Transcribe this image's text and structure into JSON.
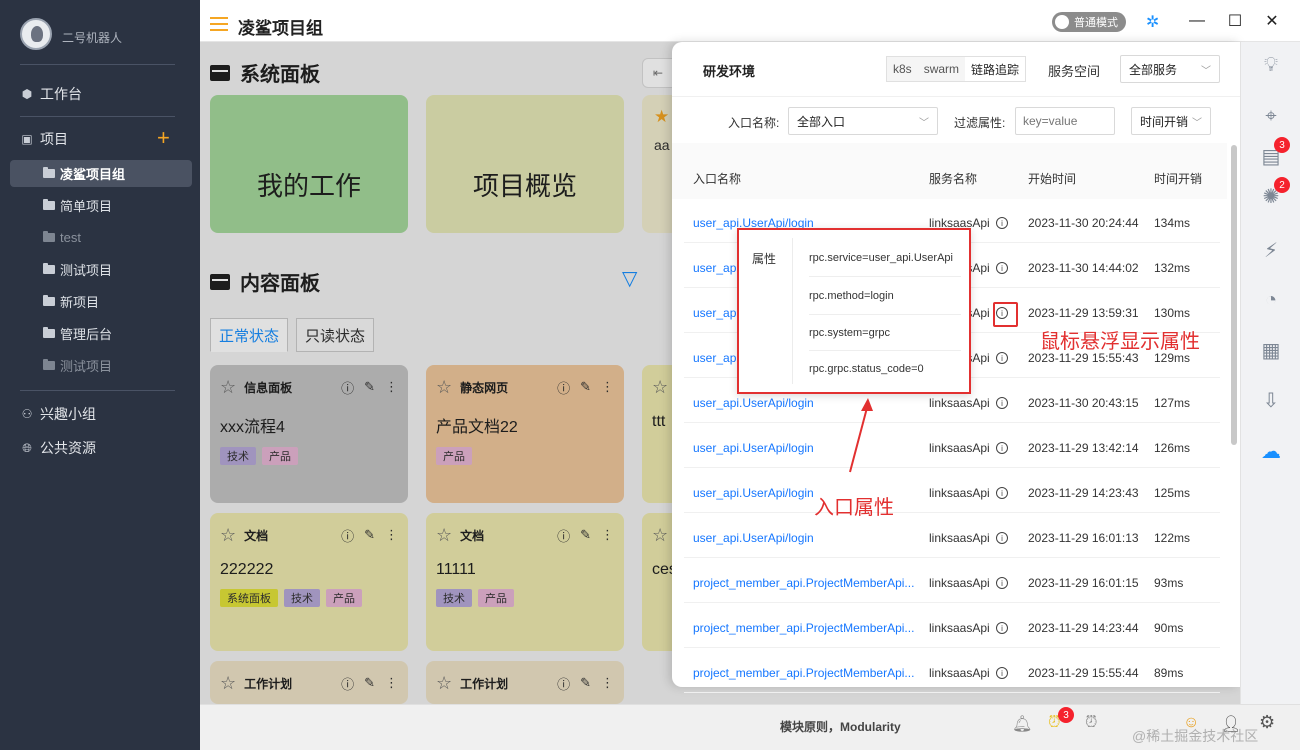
{
  "sidebar": {
    "username": "二号机器人",
    "workbench": "工作台",
    "projects_label": "项目",
    "projects": [
      {
        "label": "凌鲨项目组",
        "active": true
      },
      {
        "label": "简单项目"
      },
      {
        "label": "test",
        "dim": true
      },
      {
        "label": "测试项目"
      },
      {
        "label": "新项目"
      },
      {
        "label": "管理后台"
      },
      {
        "label": "测试项目",
        "dim": true
      }
    ],
    "interest_group": "兴趣小组",
    "public_resources": "公共资源"
  },
  "titlebar": {
    "title": "凌鲨项目组",
    "mode_label": "普通模式"
  },
  "main": {
    "system_panel_title": "系统面板",
    "system_cards": [
      "我的工作",
      "项目概览",
      "aa"
    ],
    "content_panel_title": "内容面板",
    "tabs": [
      "正常状态",
      "只读状态"
    ],
    "cards_row1": [
      {
        "type": "信息面板",
        "body": "xxx流程4",
        "tags": [
          "技术",
          "产品"
        ],
        "color": "#c4c4c4"
      },
      {
        "type": "静态网页",
        "body": "产品文档22",
        "tags": [
          "产品"
        ],
        "color": "#efc89c"
      },
      {
        "type": "",
        "body": "ttt",
        "tags": [],
        "color": "#eeeab0"
      }
    ],
    "cards_row2": [
      {
        "type": "文档",
        "body": "222222",
        "tags": [
          "系统面板",
          "技术",
          "产品"
        ],
        "color": "#eeeab0"
      },
      {
        "type": "文档",
        "body": "11111",
        "tags": [
          "技术",
          "产品"
        ],
        "color": "#eeeab0"
      },
      {
        "type": "",
        "body": "ces",
        "tags": [],
        "color": "#eeeab0"
      }
    ],
    "cards_row3": [
      {
        "type": "工作计划"
      },
      {
        "type": "工作计划"
      }
    ]
  },
  "drawer": {
    "title": "研发环境",
    "segments": [
      "k8s",
      "swarm",
      "链路追踪"
    ],
    "service_space_label": "服务空间",
    "service_space_value": "全部服务",
    "entry_label": "入口名称:",
    "entry_value": "全部入口",
    "filter_label": "过滤属性:",
    "filter_placeholder": "key=value",
    "time_sort_value": "时间开销",
    "columns": [
      "入口名称",
      "服务名称",
      "开始时间",
      "时间开销"
    ],
    "rows": [
      {
        "entry": "user_api.UserApi/login",
        "service": "linksaasApi",
        "start": "2023-11-30 20:24:44",
        "cost": "134ms"
      },
      {
        "entry": "user_api.UserApi/login",
        "service": "linksaasApi",
        "start": "2023-11-30 14:44:02",
        "cost": "132ms"
      },
      {
        "entry": "user_api.UserApi/login",
        "service": "linksaasApi",
        "start": "2023-11-29 13:59:31",
        "cost": "130ms"
      },
      {
        "entry": "user_api.UserApi/login",
        "service": "linksaasApi",
        "start": "2023-11-29 15:55:43",
        "cost": "129ms"
      },
      {
        "entry": "user_api.UserApi/login",
        "service": "linksaasApi",
        "start": "2023-11-30 20:43:15",
        "cost": "127ms"
      },
      {
        "entry": "user_api.UserApi/login",
        "service": "linksaasApi",
        "start": "2023-11-29 13:42:14",
        "cost": "126ms"
      },
      {
        "entry": "user_api.UserApi/login",
        "service": "linksaasApi",
        "start": "2023-11-29 14:23:43",
        "cost": "125ms"
      },
      {
        "entry": "user_api.UserApi/login",
        "service": "linksaasApi",
        "start": "2023-11-29 16:01:13",
        "cost": "122ms"
      },
      {
        "entry": "project_member_api.ProjectMemberApi...",
        "service": "linksaasApi",
        "start": "2023-11-29 16:01:15",
        "cost": "93ms"
      },
      {
        "entry": "project_member_api.ProjectMemberApi...",
        "service": "linksaasApi",
        "start": "2023-11-29 14:23:44",
        "cost": "90ms"
      },
      {
        "entry": "project_member_api.ProjectMemberApi...",
        "service": "linksaasApi",
        "start": "2023-11-29 15:55:44",
        "cost": "89ms"
      }
    ]
  },
  "popover": {
    "label": "属性",
    "attrs": [
      "rpc.service=user_api.UserApi",
      "rpc.method=login",
      "rpc.system=grpc",
      "rpc.grpc.status_code=0"
    ]
  },
  "annotations": {
    "hover_note": "鼠标悬浮显示属性",
    "entry_note": "入口属性"
  },
  "rail": {
    "badge_doc": "3",
    "badge_bug": "2"
  },
  "statusbar": {
    "text": "模块原则，Modularity",
    "badge": "3",
    "watermark": "@稀土掘金技术社区"
  }
}
